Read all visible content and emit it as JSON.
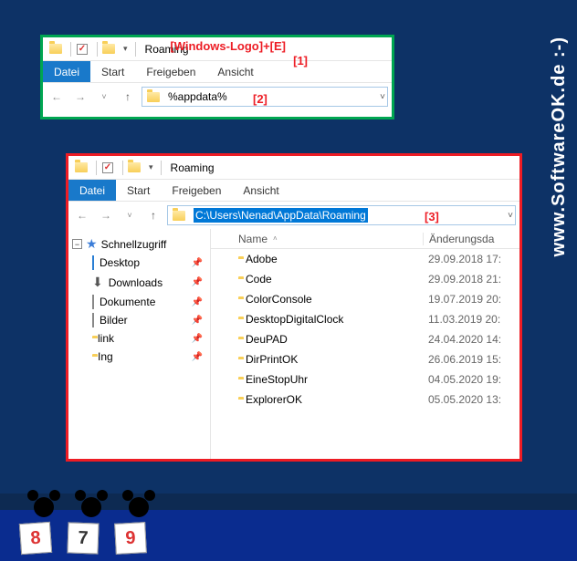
{
  "watermark": "www.SoftwareOK.de :-)",
  "annotations": {
    "a1": "[Windows-Logo]+[E]",
    "n1": "[1]",
    "n2": "[2]",
    "n3": "[3]"
  },
  "win1": {
    "title": "Roaming",
    "tabs": {
      "datei": "Datei",
      "start": "Start",
      "freigeben": "Freigeben",
      "ansicht": "Ansicht"
    },
    "address": "%appdata%"
  },
  "win2": {
    "title": "Roaming",
    "tabs": {
      "datei": "Datei",
      "start": "Start",
      "freigeben": "Freigeben",
      "ansicht": "Ansicht"
    },
    "address": "C:\\Users\\Nenad\\AppData\\Roaming",
    "tree": {
      "quickaccess": "Schnellzugriff",
      "items": [
        {
          "label": "Desktop",
          "icon": "desktop"
        },
        {
          "label": "Downloads",
          "icon": "dl"
        },
        {
          "label": "Dokumente",
          "icon": "doc"
        },
        {
          "label": "Bilder",
          "icon": "pic"
        },
        {
          "label": "link",
          "icon": "folder"
        },
        {
          "label": "Ing",
          "icon": "folder"
        }
      ]
    },
    "columns": {
      "name": "Name",
      "date": "Änderungsda"
    },
    "rows": [
      {
        "name": "Adobe",
        "date": "29.09.2018 17:"
      },
      {
        "name": "Code",
        "date": "29.09.2018 21:"
      },
      {
        "name": "ColorConsole",
        "date": "19.07.2019 20:"
      },
      {
        "name": "DesktopDigitalClock",
        "date": "11.03.2019 20:"
      },
      {
        "name": "DeuPAD",
        "date": "24.04.2020 14:"
      },
      {
        "name": "DirPrintOK",
        "date": "26.06.2019 15:"
      },
      {
        "name": "EineStopUhr",
        "date": "04.05.2020 19:"
      },
      {
        "name": "ExplorerOK",
        "date": "05.05.2020 13:"
      }
    ]
  },
  "cards": {
    "c1": "8",
    "c2": "7",
    "c3": "9"
  }
}
